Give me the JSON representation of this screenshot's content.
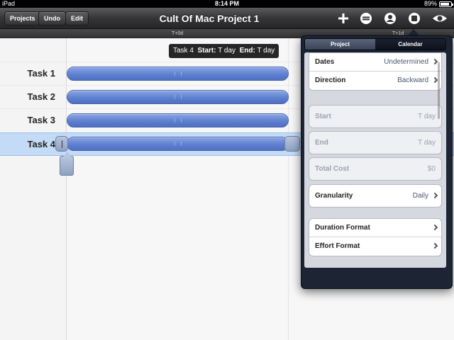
{
  "status": {
    "device": "iPad",
    "time": "8:14 PM",
    "battery": "89%",
    "battery_level": 0.89
  },
  "toolbar": {
    "projects_label": "Projects",
    "undo_label": "Undo",
    "edit_label": "Edit",
    "title": "Cult Of Mac Project 1",
    "icons": [
      "add-icon",
      "minus-icon",
      "person-icon",
      "inspector-icon",
      "eye-icon"
    ]
  },
  "timeline": {
    "t0": "T+0d",
    "t1": "T+1d"
  },
  "tooltip": {
    "task": "Task 4",
    "start_label": "Start:",
    "start_value": "T day",
    "end_label": "End:",
    "end_value": "T day"
  },
  "tasks": [
    {
      "label": "Task 1"
    },
    {
      "label": "Task 2"
    },
    {
      "label": "Task 3"
    },
    {
      "label": "Task 4",
      "selected": true
    }
  ],
  "inspector": {
    "tabs": [
      "Project",
      "Calendar"
    ],
    "active_tab": "Project",
    "dates_label": "Dates",
    "dates_value": "Undetermined",
    "direction_label": "Direction",
    "direction_value": "Backward",
    "start_label": "Start",
    "start_value": "T day",
    "end_label": "End",
    "end_value": "T day",
    "cost_label": "Total Cost",
    "cost_value": "$0",
    "granularity_label": "Granularity",
    "granularity_value": "Daily",
    "duration_format_label": "Duration Format",
    "effort_format_label": "Effort Format"
  }
}
